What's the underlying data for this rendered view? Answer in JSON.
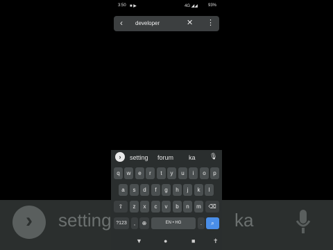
{
  "status": {
    "time": "3:50",
    "network": "4G",
    "battery": "93%"
  },
  "search": {
    "query": "developer"
  },
  "suggestions": [
    "setting",
    "forum",
    "ka"
  ],
  "keyboard": {
    "row1": [
      "q",
      "w",
      "e",
      "r",
      "t",
      "y",
      "u",
      "i",
      "o",
      "p"
    ],
    "row1_hints": [
      "1",
      "2",
      "3",
      "4",
      "5",
      "6",
      "7",
      "8",
      "9",
      "0"
    ],
    "row2": [
      "a",
      "s",
      "d",
      "f",
      "g",
      "h",
      "j",
      "k",
      "l"
    ],
    "row3": [
      "z",
      "x",
      "c",
      "v",
      "b",
      "n",
      "m"
    ],
    "sym_label": "?123",
    "comma_label": ",",
    "space_label": "EN • HG",
    "period_label": "."
  }
}
